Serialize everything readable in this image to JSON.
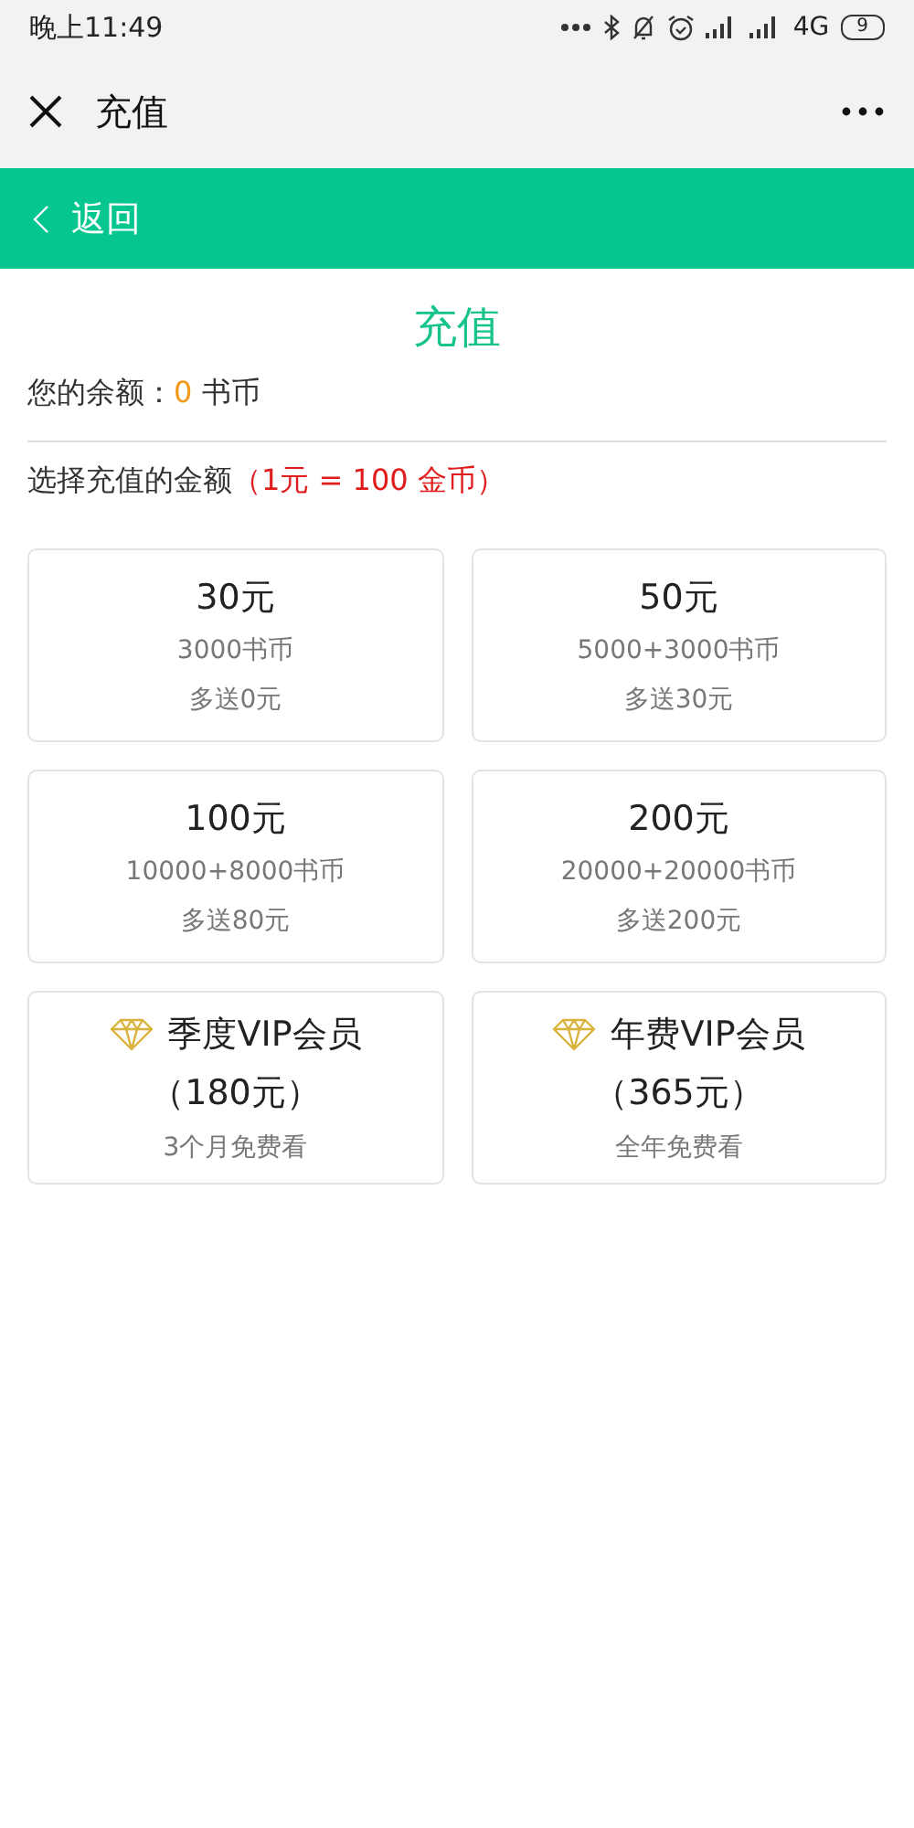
{
  "status_bar": {
    "time": "晚上11:49",
    "network": "4G",
    "battery": "9"
  },
  "title_bar": {
    "title": "充值"
  },
  "nav_bar": {
    "back": "返回"
  },
  "heading": "充值",
  "balance": {
    "label": "您的余额：",
    "value": "0",
    "unit": "书币"
  },
  "rate": {
    "label": "选择充值的金额",
    "note": "（1元 = 100 金币）"
  },
  "options": [
    {
      "kind": "coins",
      "price": "30元",
      "coins": "3000书币",
      "bonus": "多送0元"
    },
    {
      "kind": "coins",
      "price": "50元",
      "coins": "5000+3000书币",
      "bonus": "多送30元"
    },
    {
      "kind": "coins",
      "price": "100元",
      "coins": "10000+8000书币",
      "bonus": "多送80元"
    },
    {
      "kind": "coins",
      "price": "200元",
      "coins": "20000+20000书币",
      "bonus": "多送200元"
    },
    {
      "kind": "vip",
      "price": "季度VIP会员",
      "coins": "（180元）",
      "bonus": "3个月免费看"
    },
    {
      "kind": "vip",
      "price": "年费VIP会员",
      "coins": "（365元）",
      "bonus": "全年免费看"
    }
  ]
}
